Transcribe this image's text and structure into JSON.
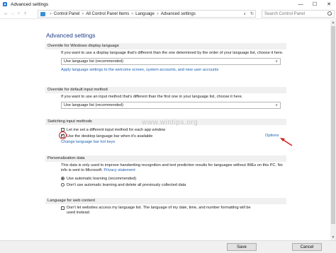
{
  "window": {
    "title": "Advanced settings",
    "controls": {
      "minimize": "—",
      "maximize": "☐",
      "close": "✕"
    }
  },
  "nav": {
    "back": "←",
    "forward": "→",
    "up": "↑",
    "breadcrumbs": [
      "Control Panel",
      "All Control Panel Items",
      "Language",
      "Advanced settings"
    ],
    "separator": ">",
    "dropdown": "∨",
    "refresh": "↻",
    "search_placeholder": "Search Control Panel"
  },
  "page": {
    "title": "Advanced settings",
    "watermark": "www.wintips.org"
  },
  "sections": {
    "display_language": {
      "header": "Override for Windows display language",
      "desc": "If you want to use a display language that's different than the one determined by the order of your language list, choose it here.",
      "select": "Use language list (recommended)",
      "link": "Apply language settings to the welcome screen, system accounts, and new user accounts"
    },
    "input_method": {
      "header": "Override for default input method",
      "desc": "If you want to use an input method that's different than the first one in your language list, choose it here.",
      "select": "Use language list (recommended)"
    },
    "switching": {
      "header": "Switching input methods",
      "check1": "Let me set a different input method for each app window",
      "check1_checked": false,
      "check2": "Use the desktop language bar when it's available",
      "check2_checked": true,
      "options_link": "Options",
      "hotkeys_link": "Change language bar hot keys"
    },
    "personalization": {
      "header": "Personalization data",
      "desc_prefix": "This data is only used to improve handwriting recognition and text prediction results for languages without IMEs on this PC. No info is sent to Microsoft.",
      "privacy_link": "Privacy statement",
      "radio1": "Use automatic learning (recommended)",
      "radio1_selected": true,
      "radio2": "Don't use automatic learning and delete all previously collected data",
      "radio2_selected": false
    },
    "web_content": {
      "header": "Language for web content",
      "check": "Don't let websites access my language list. The language of my date, time, and number formatting will be used instead.",
      "check_checked": false
    }
  },
  "footer": {
    "save": "Save",
    "cancel": "Cancel"
  },
  "colors": {
    "accent": "#1f3d8a",
    "link": "#1a5fb4",
    "highlight": "#d62020"
  }
}
